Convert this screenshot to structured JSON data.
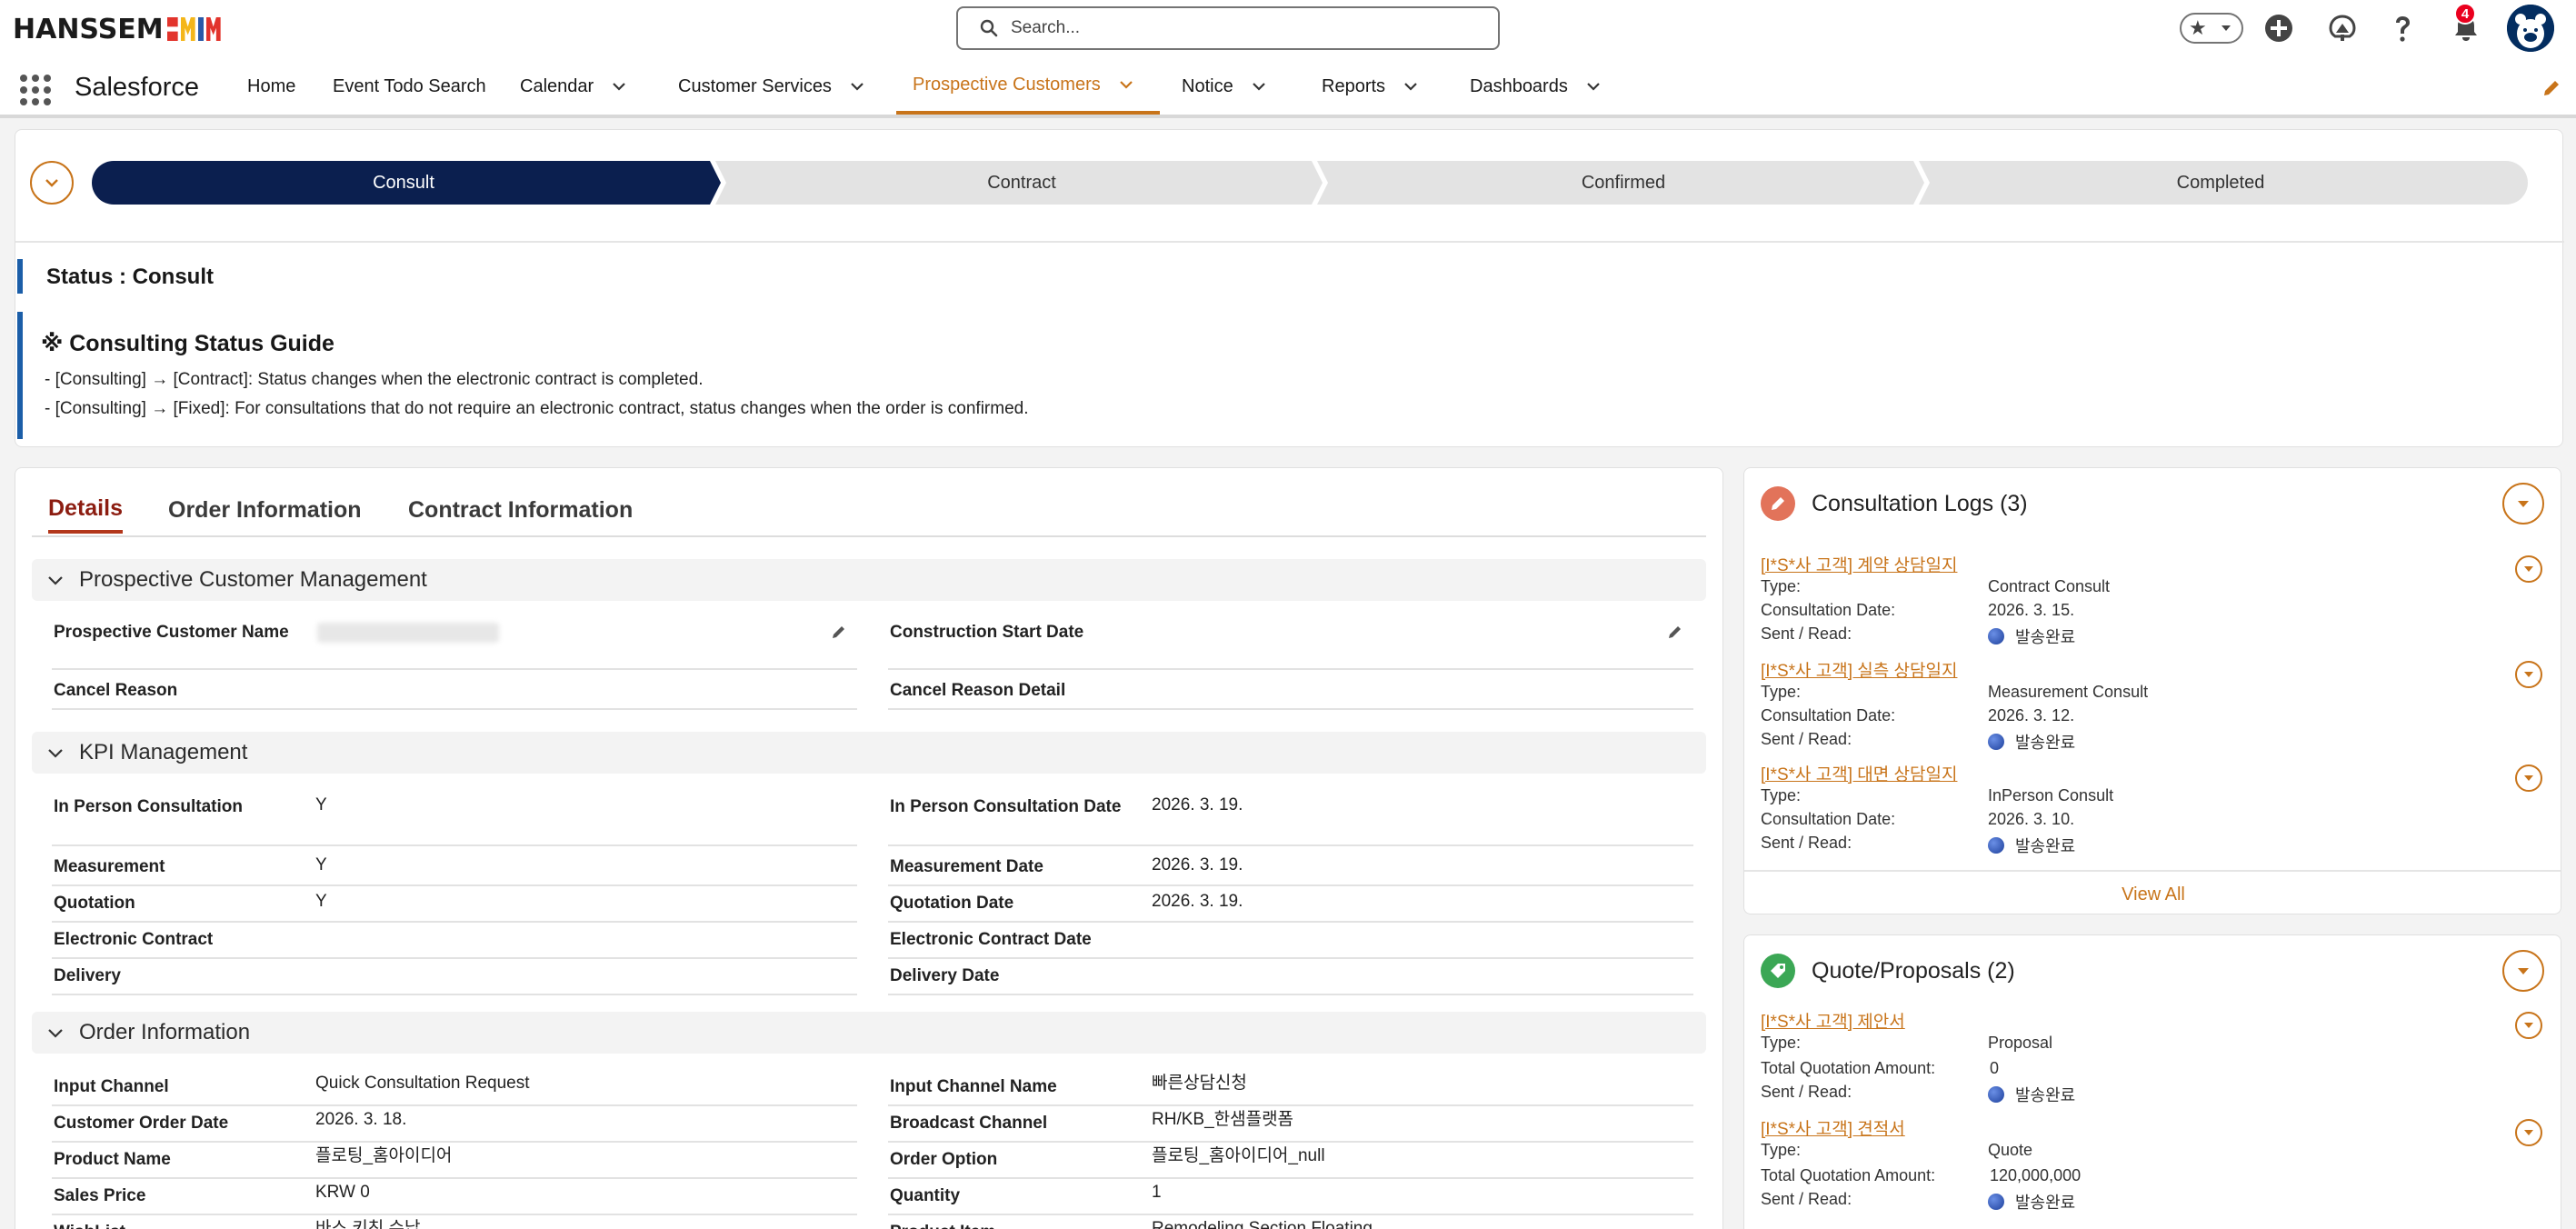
{
  "header": {
    "logo_text": "HANSSEM",
    "logo_colors": [
      "#e2342c",
      "#f4b61a",
      "#2a5aa8",
      "#e2342c"
    ],
    "search_placeholder": "Search...",
    "notification_count": "4"
  },
  "nav": {
    "app_name": "Salesforce",
    "items": [
      {
        "label": "Home",
        "has_menu": false
      },
      {
        "label": "Event Todo Search",
        "has_menu": false
      },
      {
        "label": "Calendar",
        "has_menu": true
      },
      {
        "label": "Customer Services",
        "has_menu": true
      },
      {
        "label": "Prospective Customers",
        "has_menu": true,
        "active": true
      },
      {
        "label": "Notice",
        "has_menu": true
      },
      {
        "label": "Reports",
        "has_menu": true
      },
      {
        "label": "Dashboards",
        "has_menu": true
      }
    ],
    "accent_color": "#c8741a"
  },
  "path": {
    "stages": [
      "Consult",
      "Contract",
      "Confirmed",
      "Completed"
    ],
    "current_stage": "Consult",
    "status_title": "Status : Consult",
    "guide_title": "※ Consulting Status Guide",
    "guide_lines": [
      "- [Consulting] → [Contract]: Status changes when the electronic contract is completed.",
      "- [Consulting] → [Fixed]: For consultations that do not require an electronic contract, status changes when the order is confirmed."
    ]
  },
  "details": {
    "tabs": [
      "Details",
      "Order Information",
      "Contract Information"
    ],
    "sections": [
      {
        "title": "Prospective Customer Management",
        "rows": [
          [
            {
              "label": "Prospective Customer Name",
              "value": "",
              "editable": true
            },
            {
              "label": "Construction Start Date",
              "value": "",
              "editable": true
            }
          ],
          [
            {
              "label": "Cancel Reason",
              "value": ""
            },
            {
              "label": "Cancel Reason Detail",
              "value": ""
            }
          ]
        ]
      },
      {
        "title": "KPI Management",
        "rows": [
          [
            {
              "label": "In Person Consultation",
              "value": "Y"
            },
            {
              "label": "In Person Consultation Date",
              "value": "2026. 3. 19."
            }
          ],
          [
            {
              "label": "Measurement",
              "value": "Y"
            },
            {
              "label": "Measurement Date",
              "value": "2026. 3. 19."
            }
          ],
          [
            {
              "label": "Quotation",
              "value": "Y"
            },
            {
              "label": "Quotation Date",
              "value": "2026. 3. 19."
            }
          ],
          [
            {
              "label": "Electronic Contract",
              "value": ""
            },
            {
              "label": "Electronic Contract Date",
              "value": ""
            }
          ],
          [
            {
              "label": "Delivery",
              "value": ""
            },
            {
              "label": "Delivery Date",
              "value": ""
            }
          ]
        ]
      },
      {
        "title": "Order Information",
        "rows": [
          [
            {
              "label": "Input Channel",
              "value": "Quick Consultation Request"
            },
            {
              "label": "Input Channel Name",
              "value": "빠른상담신청"
            }
          ],
          [
            {
              "label": "Customer Order Date",
              "value": "2026. 3. 18."
            },
            {
              "label": "Broadcast Channel",
              "value": "RH/KB_한샘플랫폼"
            }
          ],
          [
            {
              "label": "Product Name",
              "value": "플로팅_홈아이디어"
            },
            {
              "label": "Order Option",
              "value": "플로팅_홈아이디어_null"
            }
          ],
          [
            {
              "label": "Sales Price",
              "value": "KRW 0"
            },
            {
              "label": "Quantity",
              "value": "1"
            }
          ],
          [
            {
              "label": "WishList",
              "value": "바스 키친 수납"
            },
            {
              "label": "Product Item",
              "value": "Remodeling Section Floating"
            }
          ]
        ]
      }
    ]
  },
  "consultation_logs": {
    "title": "Consultation Logs (3)",
    "items": [
      {
        "title": "[I*S*사 고객] 계약 상담일지",
        "fields": [
          [
            "Type:",
            "Contract Consult"
          ],
          [
            "Consultation Date:",
            "2026. 3. 15."
          ],
          [
            "Sent / Read:",
            "발송완료"
          ]
        ]
      },
      {
        "title": "[I*S*사 고객] 실측 상담일지",
        "fields": [
          [
            "Type:",
            "Measurement Consult"
          ],
          [
            "Consultation Date:",
            "2026. 3. 12."
          ],
          [
            "Sent / Read:",
            "발송완료"
          ]
        ]
      },
      {
        "title": "[I*S*사 고객] 대면 상담일지",
        "fields": [
          [
            "Type:",
            "InPerson Consult"
          ],
          [
            "Consultation Date:",
            "2026. 3. 10."
          ],
          [
            "Sent / Read:",
            "발송완료"
          ]
        ]
      }
    ],
    "view_all": "View All"
  },
  "quotes": {
    "title": "Quote/Proposals (2)",
    "items": [
      {
        "title": "[I*S*사 고객] 제안서",
        "fields": [
          [
            "Type:",
            "Proposal"
          ],
          [
            "Total Quotation Amount:",
            "0"
          ],
          [
            "Sent / Read:",
            "발송완료"
          ]
        ]
      },
      {
        "title": "[I*S*사 고객] 견적서",
        "fields": [
          [
            "Type:",
            "Quote"
          ],
          [
            "Total Quotation Amount:",
            "120,000,000"
          ],
          [
            "Sent / Read:",
            "발송완료"
          ]
        ]
      }
    ]
  }
}
